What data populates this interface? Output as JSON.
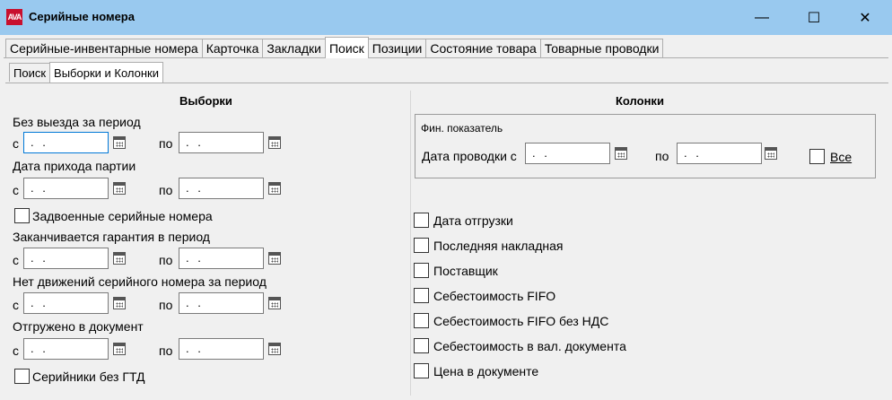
{
  "window": {
    "title": "Серийные номера",
    "logo_text": "AVA",
    "minimize_icon": "—",
    "maximize_icon": "☐",
    "close_icon": "✕"
  },
  "tabs": [
    "Серийные-инвентарные номера",
    "Карточка",
    "Закладки",
    "Поиск",
    "Позиции",
    "Состояние товара",
    "Товарные проводки"
  ],
  "active_tab": "Поиск",
  "subtabs": [
    "Поиск",
    "Выборки и Колонки"
  ],
  "active_subtab": "Выборки и Колонки",
  "left": {
    "title": "Выборки",
    "from_label": "с",
    "to_label": "по",
    "date_placeholder": " . .",
    "period1_label": "Без выезда за период",
    "period2_label": "Дата прихода партии",
    "dup_checkbox": "Задвоенные серийные номера",
    "period3_label": "Заканчивается гарантия в период",
    "period4_label": "Нет движений серийного номера за период",
    "period5_label": "Отгружено в документ",
    "no_gtd_checkbox": "Серийники без ГТД"
  },
  "right": {
    "title": "Колонки",
    "group_title": "Фин. показатель",
    "posting_from_label": "Дата проводки с",
    "posting_to_label": "по",
    "posting_date_placeholder": " . .",
    "all_label": "Все",
    "columns": [
      "Дата отгрузки",
      "Последняя накладная",
      "Поставщик",
      "Себестоимость FIFO",
      "Себестоимость FIFO без НДС",
      "Себестоимость в вал. документа",
      "Цена в документе"
    ]
  }
}
